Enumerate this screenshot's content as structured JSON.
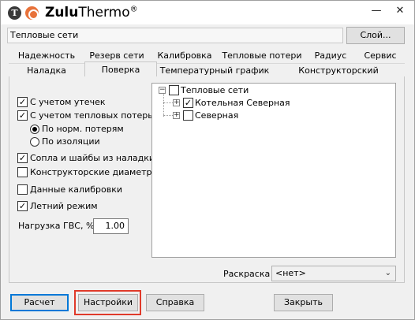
{
  "titlebar": {
    "app_name_bold": "Zulu",
    "app_name_rest": "Thermo",
    "app_name_mark": "®",
    "icon_t": "T",
    "minimize": "—",
    "close": "✕"
  },
  "top": {
    "layer_value": "Тепловые сети",
    "layers_button": "Слой..."
  },
  "tabs_row1": [
    "Надежность",
    "Резерв сети",
    "Калибровка",
    "Тепловые потери",
    "Радиус",
    "Сервис"
  ],
  "tabs_row2": [
    "Наладка",
    "Поверка",
    "Температурный график",
    "Конструкторский"
  ],
  "active_tab": "Поверка",
  "options": {
    "leaks": "С учетом утечек",
    "heat_losses": "С учетом тепловых потерь",
    "radio_norm": "По норм. потерям",
    "radio_insul": "По изоляции",
    "nozzles": "Сопла и шайбы из наладки",
    "design_diam": "Конструкторские диаметры",
    "calib_data": "Данные калибровки",
    "summer": "Летний режим",
    "gvs_label": "Нагрузка ГВС, %",
    "gvs_value": "1.00"
  },
  "tree": {
    "root": "Тепловые сети",
    "child1": "Котельная Северная",
    "child2": "Северная",
    "expand": "+",
    "collapse": "−"
  },
  "coloring": {
    "label": "Раскраска",
    "value": "<нет>"
  },
  "buttons": {
    "calc": "Расчет",
    "settings": "Настройки",
    "help": "Справка",
    "close": "Закрыть"
  },
  "colors": {
    "highlight": "#e03a2a",
    "accent": "#0078d7"
  }
}
